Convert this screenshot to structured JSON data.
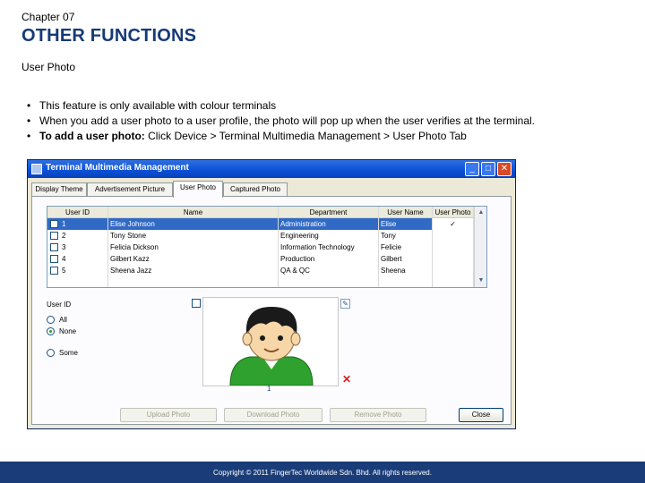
{
  "header": {
    "chapter": "Chapter 07",
    "title": "OTHER FUNCTIONS",
    "subtitle": "User Photo"
  },
  "bullets": [
    {
      "text": "This feature is only available with colour terminals"
    },
    {
      "text": "When you add a user photo to a user profile, the photo will pop up when the user verifies at the terminal."
    },
    {
      "bold": "To add a user photo:",
      "text": " Click Device > Terminal Multimedia Management > User Photo Tab"
    }
  ],
  "window": {
    "title": "Terminal Multimedia Management",
    "controls": {
      "minimize": "_",
      "maximize": "□",
      "close": "✕"
    },
    "tabs": [
      "Display Theme",
      "Advertisement Picture",
      "User Photo",
      "Captured Photo"
    ],
    "active_tab": "User Photo",
    "table": {
      "columns": [
        "User ID",
        "Name",
        "Department",
        "User Name",
        "User Photo"
      ],
      "rows": [
        {
          "id": "1",
          "name": "Elise Johnson",
          "department": "Administration",
          "username": "Elise",
          "photo": "✓",
          "selected": true
        },
        {
          "id": "2",
          "name": "Tony Stone",
          "department": "Engineering",
          "username": "Tony",
          "photo": "",
          "selected": false
        },
        {
          "id": "3",
          "name": "Felicia Dickson",
          "department": "Information Technology",
          "username": "Felicie",
          "photo": "",
          "selected": false
        },
        {
          "id": "4",
          "name": "Gilbert Kazz",
          "department": "Production",
          "username": "Gilbert",
          "photo": "",
          "selected": false
        },
        {
          "id": "5",
          "name": "Sheena Jazz",
          "department": "QA & QC",
          "username": "Sheena",
          "photo": "",
          "selected": false
        }
      ]
    },
    "user_id_group": {
      "label": "User ID",
      "options": [
        "All",
        "None",
        "Some"
      ],
      "selected": "None"
    },
    "photo_index": "1",
    "buttons": {
      "upload": "Upload Photo",
      "download": "Download Photo",
      "remove": "Remove Photo",
      "close": "Close"
    }
  },
  "footer": {
    "copyright": "Copyright © 2011 FingerTec Worldwide Sdn. Bhd. All rights reserved."
  },
  "colors": {
    "title": "#163a78",
    "footer": "#1a3d79",
    "selection": "#316ac5",
    "window_title": "#0a4fd6"
  }
}
